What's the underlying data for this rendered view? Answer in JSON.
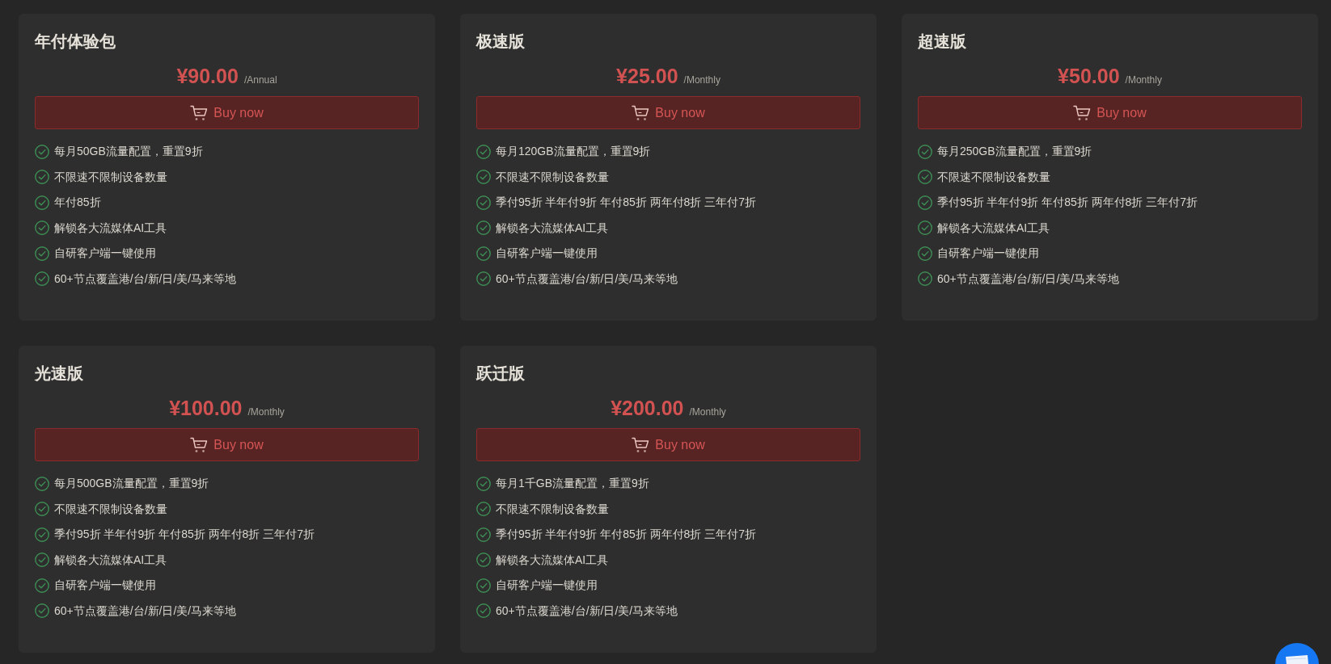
{
  "plans": [
    {
      "title": "年付体验包",
      "price": "¥90.00",
      "period": "/Annual",
      "button": "Buy now",
      "features": [
        "每月50GB流量配置，重置9折",
        "不限速不限制设备数量",
        "年付85折",
        "解锁各大流媒体AI工具",
        "自研客户端一键使用",
        "60+节点覆盖港/台/新/日/美/马来等地"
      ]
    },
    {
      "title": "极速版",
      "price": "¥25.00",
      "period": "/Monthly",
      "button": "Buy now",
      "features": [
        "每月120GB流量配置，重置9折",
        "不限速不限制设备数量",
        "季付95折 半年付9折 年付85折 两年付8折 三年付7折",
        "解锁各大流媒体AI工具",
        "自研客户端一键使用",
        "60+节点覆盖港/台/新/日/美/马来等地"
      ]
    },
    {
      "title": "超速版",
      "price": "¥50.00",
      "period": "/Monthly",
      "button": "Buy now",
      "features": [
        "每月250GB流量配置，重置9折",
        "不限速不限制设备数量",
        "季付95折 半年付9折 年付85折 两年付8折 三年付7折",
        "解锁各大流媒体AI工具",
        "自研客户端一键使用",
        "60+节点覆盖港/台/新/日/美/马来等地"
      ]
    },
    {
      "title": "光速版",
      "price": "¥100.00",
      "period": "/Monthly",
      "button": "Buy now",
      "features": [
        "每月500GB流量配置，重置9折",
        "不限速不限制设备数量",
        "季付95折 半年付9折 年付85折 两年付8折 三年付7折",
        "解锁各大流媒体AI工具",
        "自研客户端一键使用",
        "60+节点覆盖港/台/新/日/美/马来等地"
      ]
    },
    {
      "title": "跃迁版",
      "price": "¥200.00",
      "period": "/Monthly",
      "button": "Buy now",
      "features": [
        "每月1千GB流量配置，重置9折",
        "不限速不限制设备数量",
        "季付95折 半年付9折 年付85折 两年付8折 三年付7折",
        "解锁各大流媒体AI工具",
        "自研客户端一键使用",
        "60+节点覆盖港/台/新/日/美/马来等地"
      ]
    }
  ]
}
